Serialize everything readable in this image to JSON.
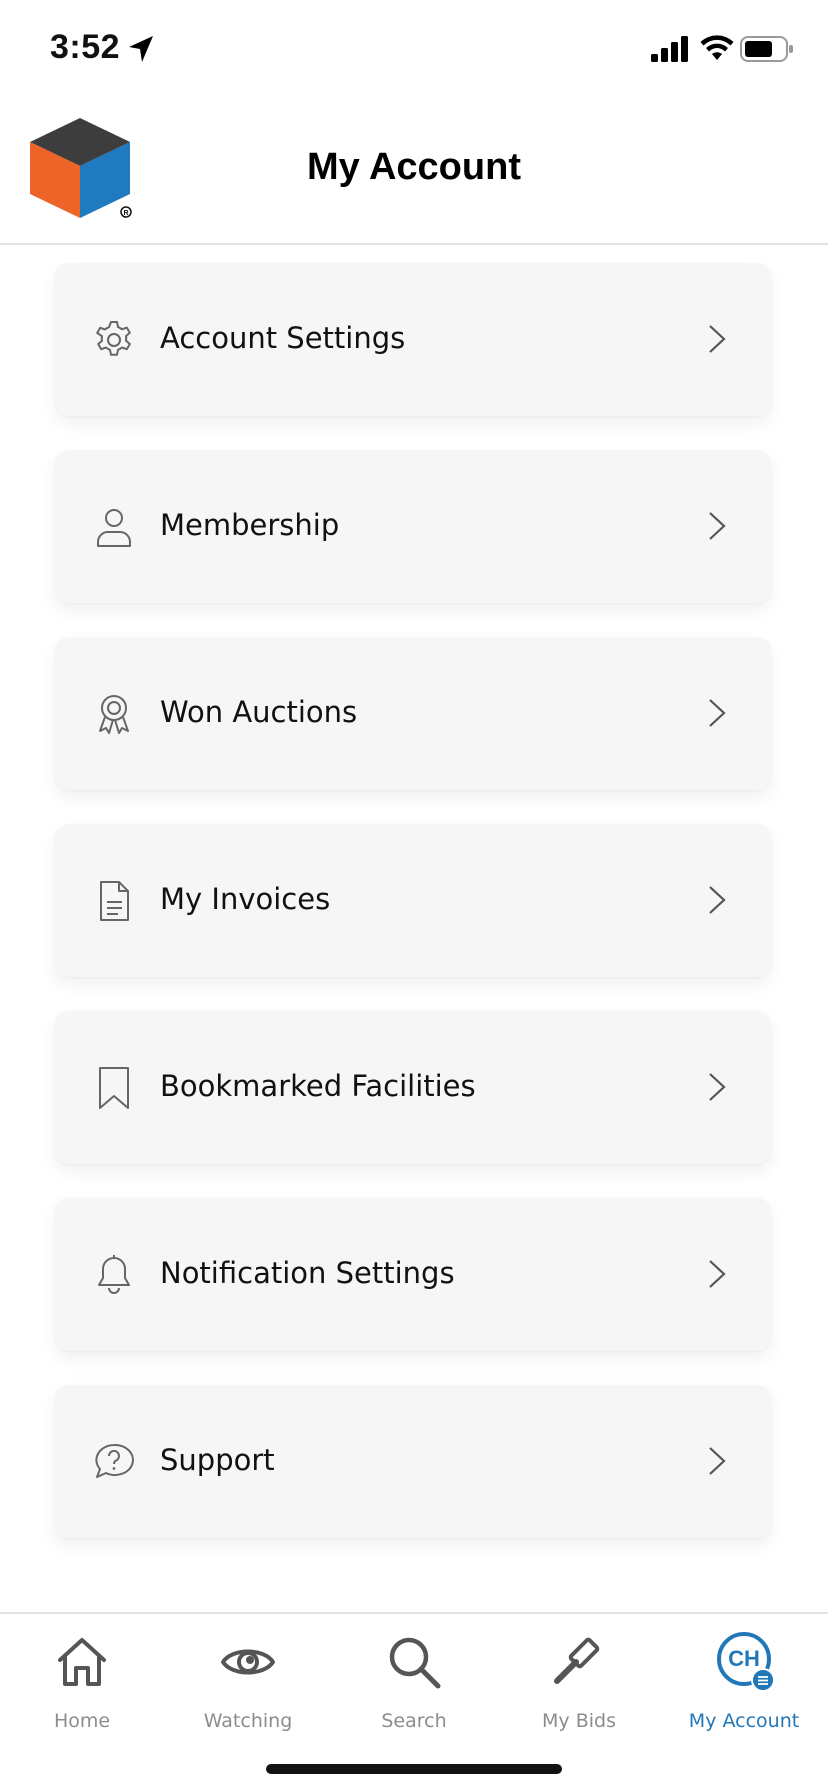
{
  "status_bar": {
    "time": "3:52",
    "icons": [
      "location-arrow-icon",
      "cellular-signal-icon",
      "wifi-icon",
      "battery-icon"
    ]
  },
  "header": {
    "title": "My Account",
    "logo": "cube-logo"
  },
  "menu": {
    "items": [
      {
        "label": "Account Settings",
        "icon": "gear-icon"
      },
      {
        "label": "Membership",
        "icon": "person-icon"
      },
      {
        "label": "Won Auctions",
        "icon": "award-ribbon-icon"
      },
      {
        "label": "My Invoices",
        "icon": "document-icon"
      },
      {
        "label": "Bookmarked Facilities",
        "icon": "bookmark-icon"
      },
      {
        "label": "Notification Settings",
        "icon": "bell-icon"
      },
      {
        "label": "Support",
        "icon": "question-bubble-icon"
      }
    ]
  },
  "tab_bar": {
    "tabs": [
      {
        "label": "Home",
        "icon": "home-icon",
        "active": false
      },
      {
        "label": "Watching",
        "icon": "eye-icon",
        "active": false
      },
      {
        "label": "Search",
        "icon": "search-icon",
        "active": false
      },
      {
        "label": "My Bids",
        "icon": "gavel-icon",
        "active": false
      },
      {
        "label": "My Account",
        "icon": "avatar",
        "active": true,
        "avatar_initials": "CH"
      }
    ]
  },
  "colors": {
    "accent": "#2277b8",
    "inactive_tab": "#8c8c8c",
    "card_bg": "#f6f6f6",
    "logo_orange": "#ee6328",
    "logo_blue": "#1f7ac0",
    "logo_dark": "#3d3d3d"
  }
}
